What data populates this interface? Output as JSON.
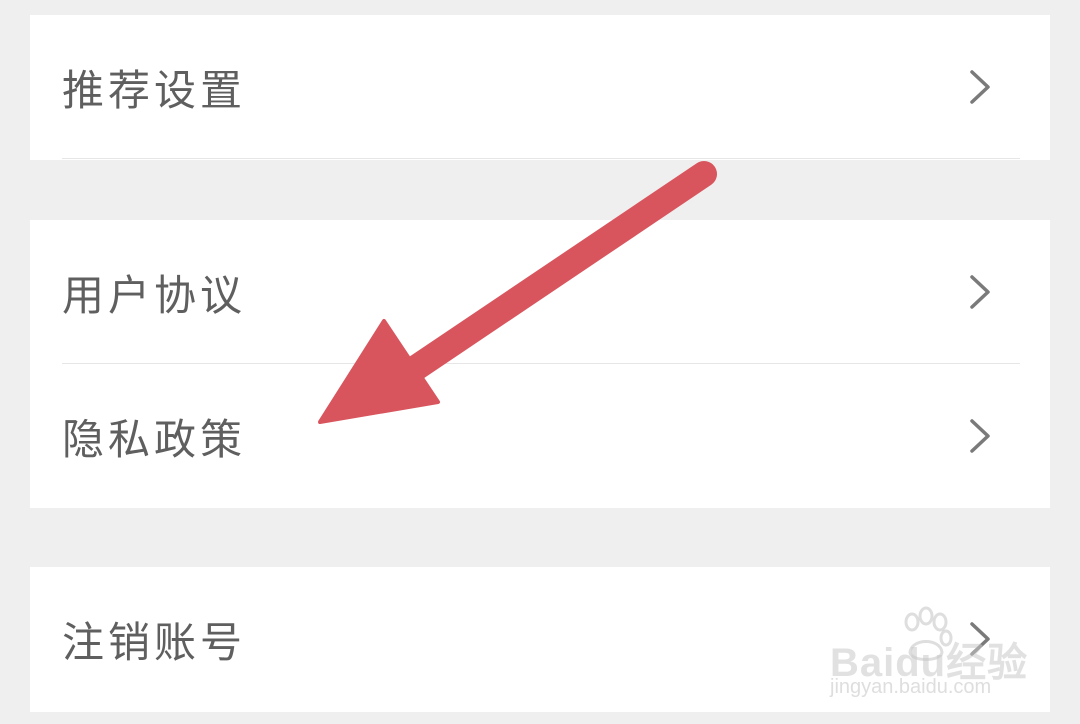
{
  "settings": {
    "items": [
      {
        "label": "推荐设置"
      },
      {
        "label": "用户协议"
      },
      {
        "label": "隐私政策"
      },
      {
        "label": "注销账号"
      }
    ]
  },
  "annotation": {
    "arrow_color": "#d9555e",
    "points_to": "隐私政策"
  },
  "watermark": {
    "brand": "Baidu经验",
    "url": "jingyan.baidu.com"
  },
  "icons": {
    "chevron": "chevron-right-icon"
  }
}
